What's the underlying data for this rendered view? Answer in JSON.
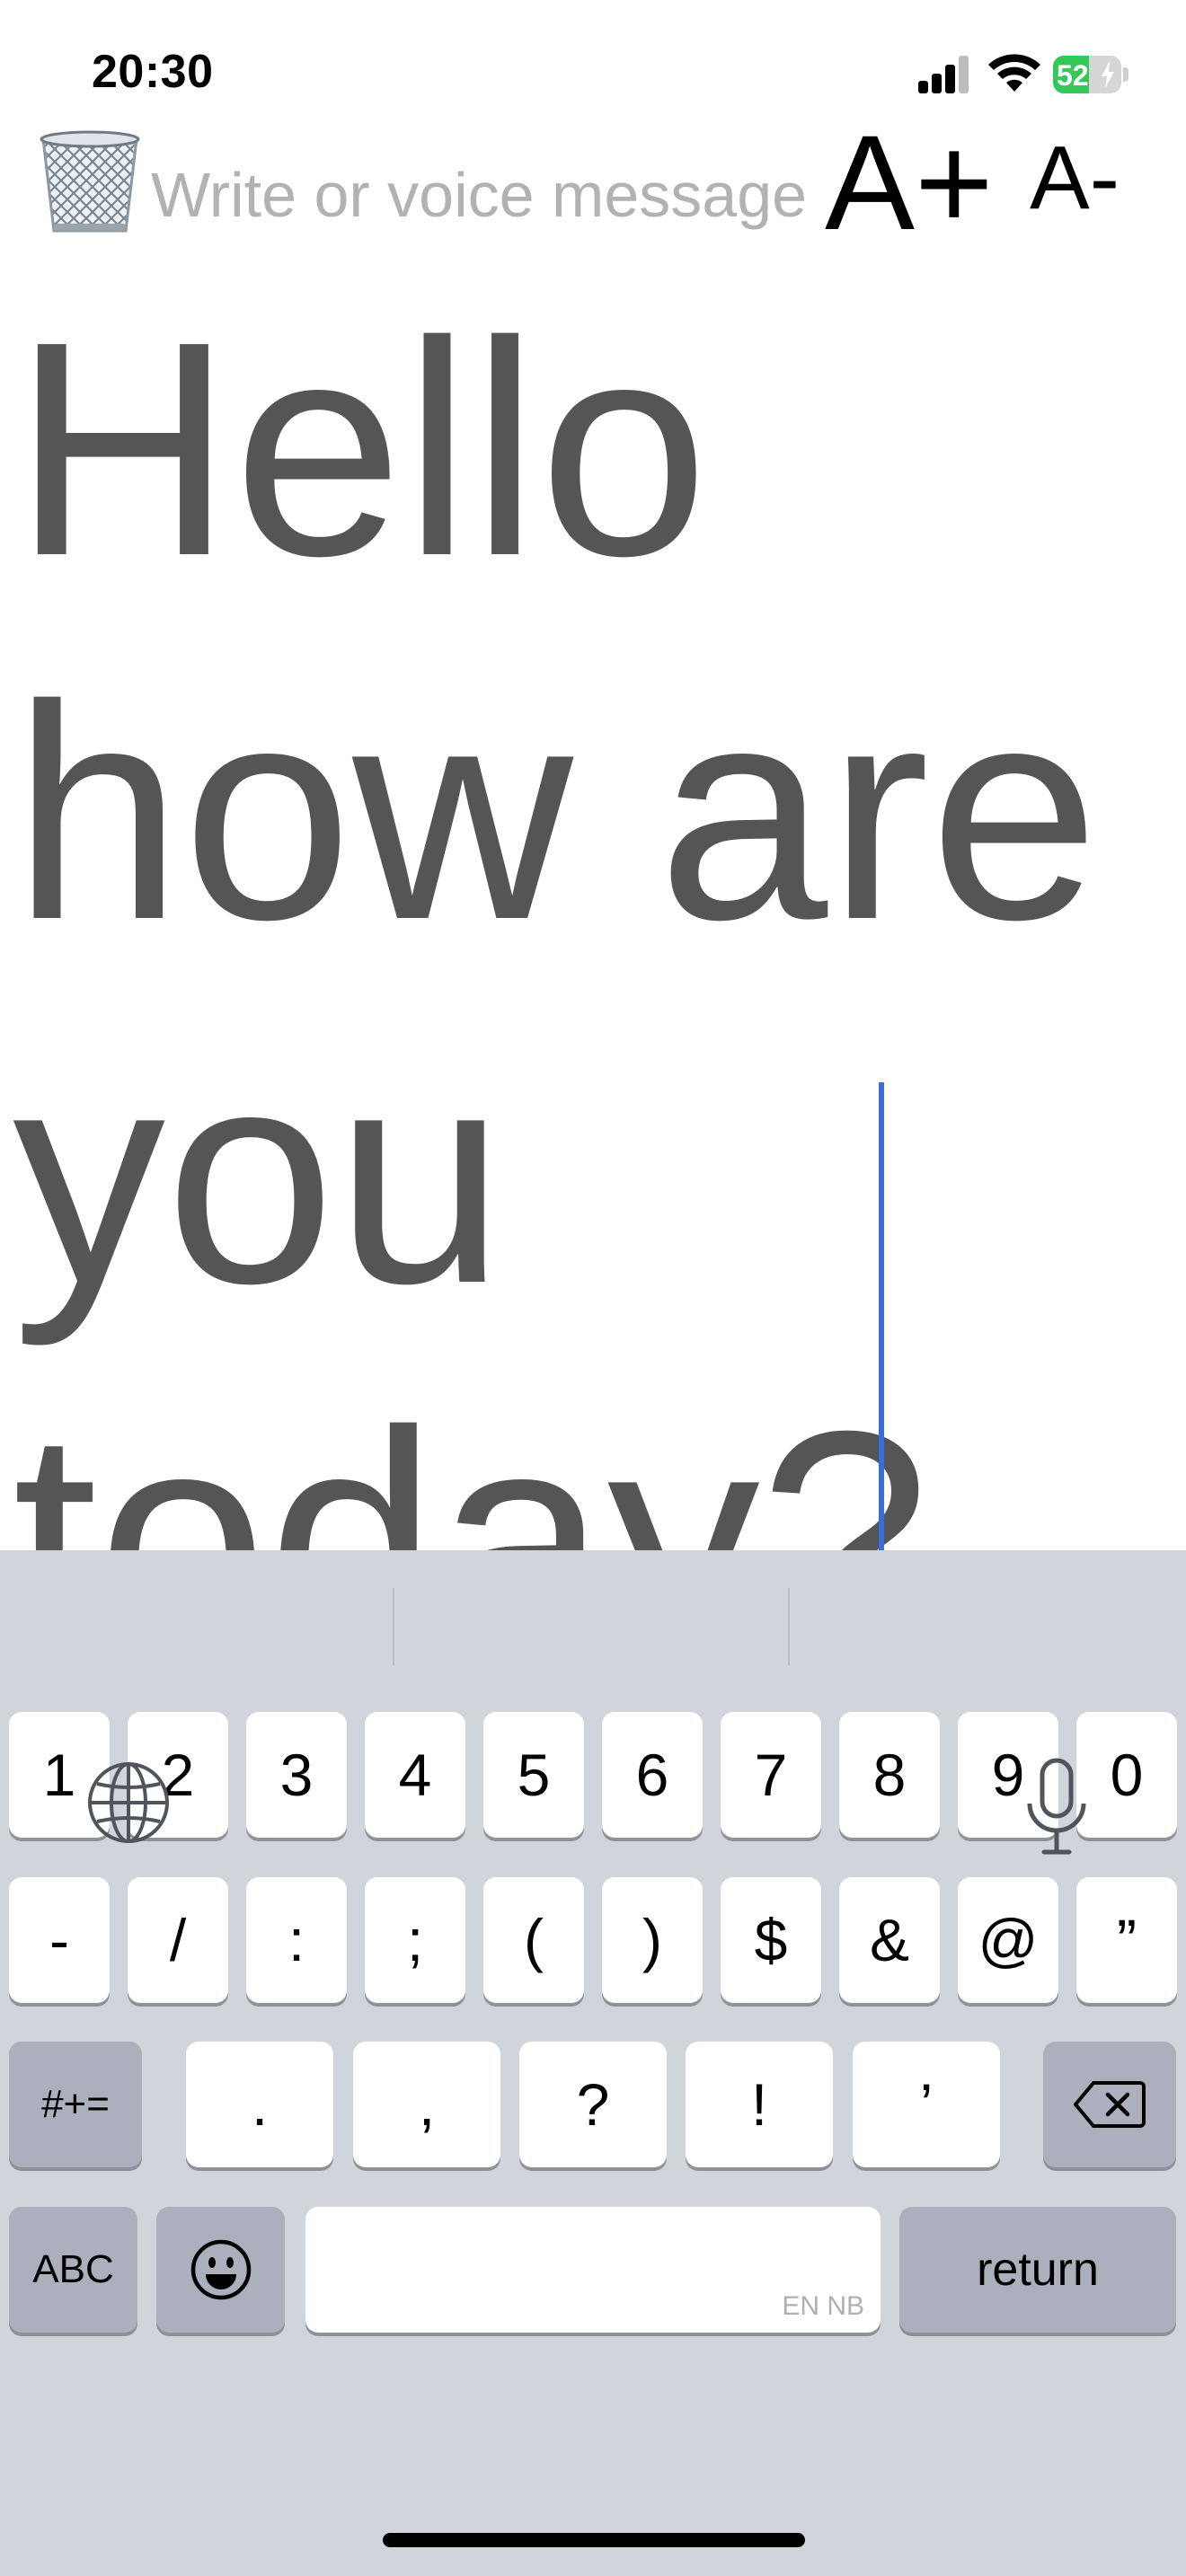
{
  "status_bar": {
    "time": "20:30",
    "battery_percent": "52",
    "battery_level": 0.52,
    "signal_bars": 3,
    "icons": [
      "signal-icon",
      "wifi-icon",
      "battery-charging-icon"
    ]
  },
  "toolbar": {
    "trash_icon": "wastebasket-icon",
    "input_placeholder": "Write or voice message",
    "font_increase_label": "A+",
    "font_decrease_label": "A-"
  },
  "content": {
    "lines": [
      "Hello",
      "how are",
      "you",
      "today?"
    ]
  },
  "keyboard": {
    "row1": [
      "1",
      "2",
      "3",
      "4",
      "5",
      "6",
      "7",
      "8",
      "9",
      "0"
    ],
    "row2": [
      "-",
      "/",
      ":",
      ";",
      "(",
      ")",
      "$",
      "&",
      "@",
      "”"
    ],
    "row3_mode": "#+=",
    "row3": [
      ".",
      ",",
      "?",
      "!",
      "’"
    ],
    "abc_label": "ABC",
    "space_language": "EN NB",
    "return_label": "return",
    "icons": [
      "delete-icon",
      "emoji-icon",
      "globe-icon",
      "microphone-icon"
    ]
  },
  "colors": {
    "text": "#555555",
    "placeholder": "#b2b2b2",
    "caret": "#3a6dd8",
    "keyboard_bg": "#d1d4db",
    "battery_green": "#34c759"
  }
}
